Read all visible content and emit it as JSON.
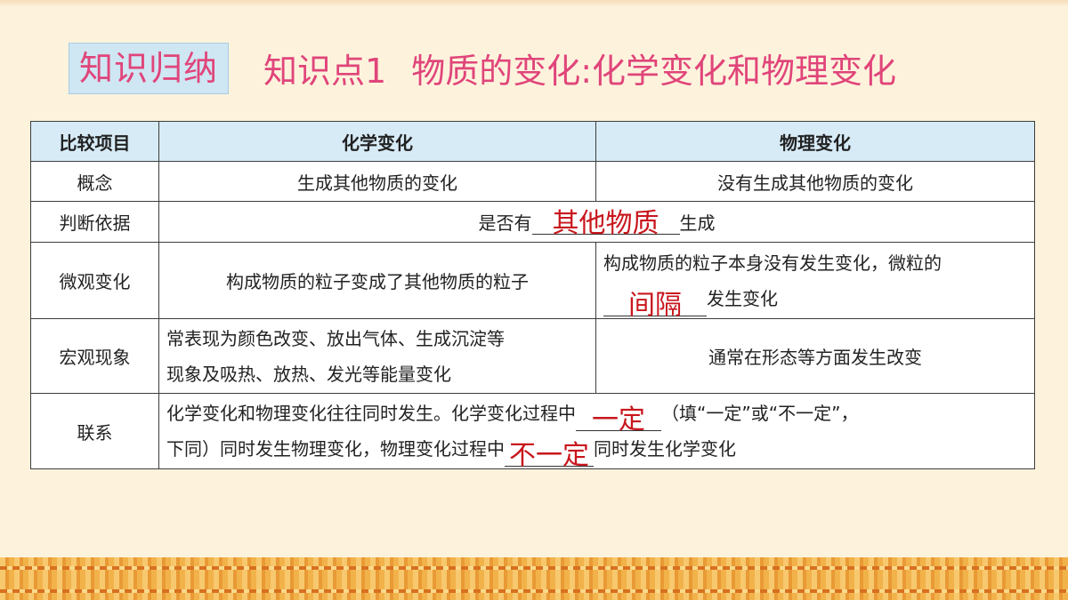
{
  "header": {
    "tag": "知识归纳",
    "point_label": "知识点1",
    "point_title": "物质的变化:化学变化和物理变化"
  },
  "table": {
    "headers": [
      "比较项目",
      "化学变化",
      "物理变化"
    ],
    "concept": {
      "label": "概念",
      "chemical": "生成其他物质的变化",
      "physical": "没有生成其他物质的变化"
    },
    "judgement": {
      "label": "判断依据",
      "before": "是否有",
      "answer": "其他物质",
      "after": "生成"
    },
    "micro": {
      "label": "微观变化",
      "chemical": "构成物质的粒子变成了其他物质的粒子",
      "physical_line1": "构成物质的粒子本身没有发生变化，微粒的",
      "physical_answer": "间隔",
      "physical_after": "发生变化"
    },
    "macro": {
      "label": "宏观现象",
      "chemical_line1": "常表现为颜色改变、放出气体、生成沉淀等",
      "chemical_line2": "现象及吸热、放热、发光等能量变化",
      "physical": "通常在形态等方面发生改变"
    },
    "relation": {
      "label": "联系",
      "text1": "化学变化和物理变化往往同时发生。化学变化过程中",
      "answer1": "一定",
      "text2": "（填“一定”或“不一定”，",
      "text3": "下同）同时发生物理变化，物理变化过程中",
      "answer2": "不一定",
      "text4": "同时发生化学变化"
    }
  },
  "colors": {
    "title": "#e0457a",
    "answer": "#c8161d",
    "header_bg": "#d7ebf7",
    "background": "#fdf3dd"
  }
}
